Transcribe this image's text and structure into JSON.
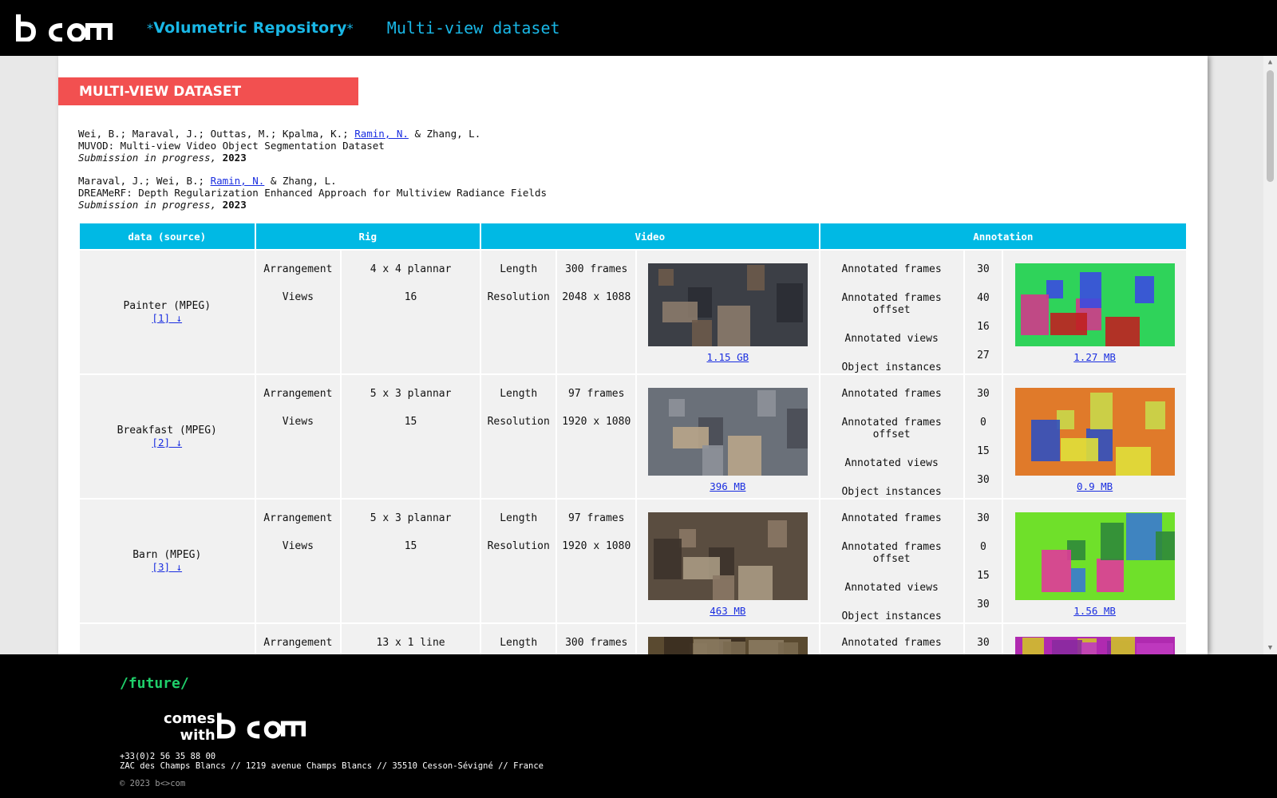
{
  "header": {
    "logo_text": "b<>com",
    "brand_title": "Volumetric Repository",
    "star": "*",
    "subtitle": "Multi-view dataset"
  },
  "banner": {
    "title": "MULTI-VIEW DATASET"
  },
  "references": [
    {
      "authors_before": "Wei, B.; Maraval, J.; Outtas, M.; Kpalma, K.; ",
      "author_link": "Ramin, N.",
      "authors_after": " & Zhang, L.",
      "title": "MUVOD: Multi-view Video Object Segmentation Dataset",
      "status": "Submission in progress, ",
      "year": "2023"
    },
    {
      "authors_before": "Maraval, J.; Wei, B.; ",
      "author_link": "Ramin, N.",
      "authors_after": " & Zhang, L.",
      "title": "DREAMeRF: Depth Regularization Enhanced Approach for Multiview Radiance Fields",
      "status": "Submission in progress, ",
      "year": "2023"
    }
  ],
  "table": {
    "headers": {
      "data": "data (source)",
      "rig": "Rig",
      "video": "Video",
      "annotation": "Annotation"
    },
    "labels": {
      "arrangement": "Arrangement",
      "views": "Views",
      "length": "Length",
      "resolution": "Resolution",
      "annotated_frames": "Annotated frames",
      "annotated_frames_offset": "Annotated frames offset",
      "annotated_views": "Annotated views",
      "object_instances": "Object instances"
    },
    "rows": [
      {
        "name": "Painter (MPEG)",
        "ref": "[1] ↓",
        "arrangement": "4 x 4 plannar",
        "views": "16",
        "length": "300 frames",
        "resolution": "2048 x 1088",
        "video_size": "1.15 GB",
        "annotated_frames": "30",
        "annotated_frames_offset": "40",
        "annotated_views": "16",
        "object_instances": "27",
        "annotation_size": "1.27 MB"
      },
      {
        "name": "Breakfast (MPEG)",
        "ref": "[2] ↓",
        "arrangement": "5 x 3 plannar",
        "views": "15",
        "length": "97 frames",
        "resolution": "1920 x 1080",
        "video_size": "396 MB",
        "annotated_frames": "30",
        "annotated_frames_offset": "0",
        "annotated_views": "15",
        "object_instances": "30",
        "annotation_size": "0.9 MB"
      },
      {
        "name": "Barn (MPEG)",
        "ref": "[3] ↓",
        "arrangement": "5 x 3 plannar",
        "views": "15",
        "length": "97 frames",
        "resolution": "1920 x 1080",
        "video_size": "463 MB",
        "annotated_frames": "30",
        "annotated_frames_offset": "0",
        "annotated_views": "15",
        "object_instances": "30",
        "annotation_size": "1.56 MB"
      },
      {
        "name": "",
        "ref": "",
        "arrangement": "13 x 1 line",
        "views": "",
        "length": "300 frames",
        "resolution": "",
        "video_size": "",
        "annotated_frames": "30",
        "annotated_frames_offset": "",
        "annotated_views": "",
        "object_instances": "",
        "annotation_size": ""
      }
    ]
  },
  "footer": {
    "future": "/future/",
    "comes_line1": "comes",
    "comes_line2": "with",
    "phone": "+33(0)2 56 35 88 00",
    "address": "ZAC des Champs Blancs // 1219 avenue Champs Blancs // 35510 Cesson-Sévigné // France",
    "copyright": "© 2023 b<>com"
  },
  "colors": {
    "accent": "#00b9e4",
    "banner": "#f25050",
    "future": "#1fcf6a",
    "link": "#1a2ee0"
  }
}
